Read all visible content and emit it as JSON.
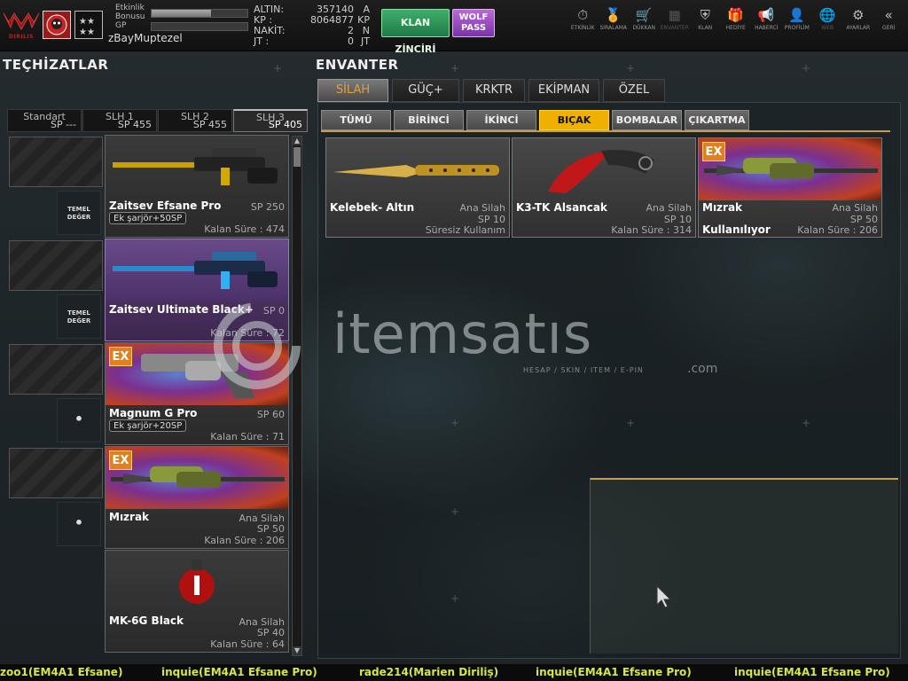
{
  "header": {
    "logo_text": "DIRILIS",
    "bonus_label": "Etkinlik Bonusu",
    "bonus_fill": 0.62,
    "gp_label": "GP",
    "gp_fill": 0.0,
    "username": "zBayMuptezel",
    "rank_glyph": "★★★★",
    "currency": [
      {
        "label": "ALTIN:",
        "value": "357140",
        "unit": "A"
      },
      {
        "label": "KP   :",
        "value": "8064877",
        "unit": "KP"
      },
      {
        "label": "NAKİT:",
        "value": "2",
        "unit": "N"
      },
      {
        "label": "JT   :",
        "value": "0",
        "unit": "JT"
      }
    ],
    "klan_button": "KLAN ZİNCİRİ",
    "wolf_button": "WOLF PASS",
    "nav": [
      {
        "label": "ETKİNLİK",
        "icon": "stopwatch-icon",
        "glyph": "⏱",
        "dim": false
      },
      {
        "label": "SIRALAMA",
        "icon": "medal-icon",
        "glyph": "🏅",
        "dim": false
      },
      {
        "label": "DÜKKAN",
        "icon": "cart-icon",
        "glyph": "🛒",
        "dim": false
      },
      {
        "label": "ENVANTER",
        "icon": "inventory-icon",
        "glyph": "▦",
        "dim": true
      },
      {
        "label": "KLAN",
        "icon": "shield-icon",
        "glyph": "⛨",
        "dim": false
      },
      {
        "label": "HEDİYE",
        "icon": "gift-icon",
        "glyph": "🎁",
        "dim": false
      },
      {
        "label": "HABERCİ",
        "icon": "megaphone-icon",
        "glyph": "📢",
        "dim": false
      },
      {
        "label": "PROFİLİM",
        "icon": "profile-icon",
        "glyph": "👤",
        "dim": false
      },
      {
        "label": "WEB",
        "icon": "globe-icon",
        "glyph": "🌐",
        "dim": true
      },
      {
        "label": "AYARLAR",
        "icon": "gear-icon",
        "glyph": "⚙",
        "dim": false
      },
      {
        "label": "GERİ",
        "icon": "back-icon",
        "glyph": "«",
        "dim": false
      }
    ]
  },
  "left": {
    "title": "TEÇHİZATLAR",
    "slots": [
      {
        "name": "Standart",
        "sp": "SP ---"
      },
      {
        "name": "SLH 1",
        "sp": "SP 455"
      },
      {
        "name": "SLH 2",
        "sp": "SP 455"
      },
      {
        "name": "SLH 3",
        "sp": "SP 405"
      }
    ],
    "items": [
      {
        "name": "Zaitsev Efsane Pro",
        "badge": "Ek şarjör+50SP",
        "category": "",
        "sp": "SP 250",
        "time": "Kalan Süre : 474",
        "side": "TEMEL DEĞER"
      },
      {
        "name": "Zaitsev Ultimate Black+",
        "badge": "",
        "category": "",
        "sp": "SP 0",
        "time": "Kalan Süre : 72",
        "side": "TEMEL DEĞER"
      },
      {
        "name": "Magnum G Pro",
        "badge": "Ek şarjör+20SP",
        "category": "",
        "sp": "SP 60",
        "time": "Kalan Süre : 71",
        "side": "•"
      },
      {
        "name": "Mızrak",
        "badge": "",
        "category": "Ana Silah",
        "sp": "SP 50",
        "time": "Kalan Süre : 206",
        "side": "•"
      },
      {
        "name": "MK-6G Black",
        "badge": "",
        "category": "Ana Silah",
        "sp": "SP 40",
        "time": "Kalan Süre : 64",
        "side": ""
      }
    ]
  },
  "right": {
    "title": "ENVANTER",
    "tabs": [
      "SİLAH",
      "GÜÇ+",
      "KRKTR",
      "EKİPMAN",
      "ÖZEL"
    ],
    "active_tab": 0,
    "subtabs": [
      "TÜMÜ",
      "BİRİNCİ",
      "İKİNCİ",
      "BIÇAK",
      "BOMBALAR",
      "ÇIKARTMA"
    ],
    "active_subtab": 3,
    "items": [
      {
        "name": "Kelebek- Altın",
        "category": "Ana Silah",
        "sp": "SP 10",
        "time": "Süresiz Kullanım",
        "status": ""
      },
      {
        "name": "K3-TK Alsancak",
        "category": "Ana Silah",
        "sp": "SP 10",
        "time": "Kalan Süre : 314",
        "status": ""
      },
      {
        "name": "Mızrak",
        "category": "Ana Silah",
        "sp": "SP 50",
        "time": "Kalan Süre : 206",
        "status": "Kullanılıyor"
      }
    ]
  },
  "watermark": {
    "text": "itemsatıs",
    "sub": "HESAP / SKIN / ITEM / E-PIN",
    "com": ".com"
  },
  "ticker": [
    "zoo1(EM4A1 Efsane)",
    "inquie(EM4A1 Efsane Pro)",
    "rade214(Marien Diriliş)",
    "inquie(EM4A1 Efsane Pro)",
    "inquie(EM4A1 Efsane Pro)"
  ],
  "ex_label": "EX",
  "side_item_label": "TEMEL DEĞER"
}
